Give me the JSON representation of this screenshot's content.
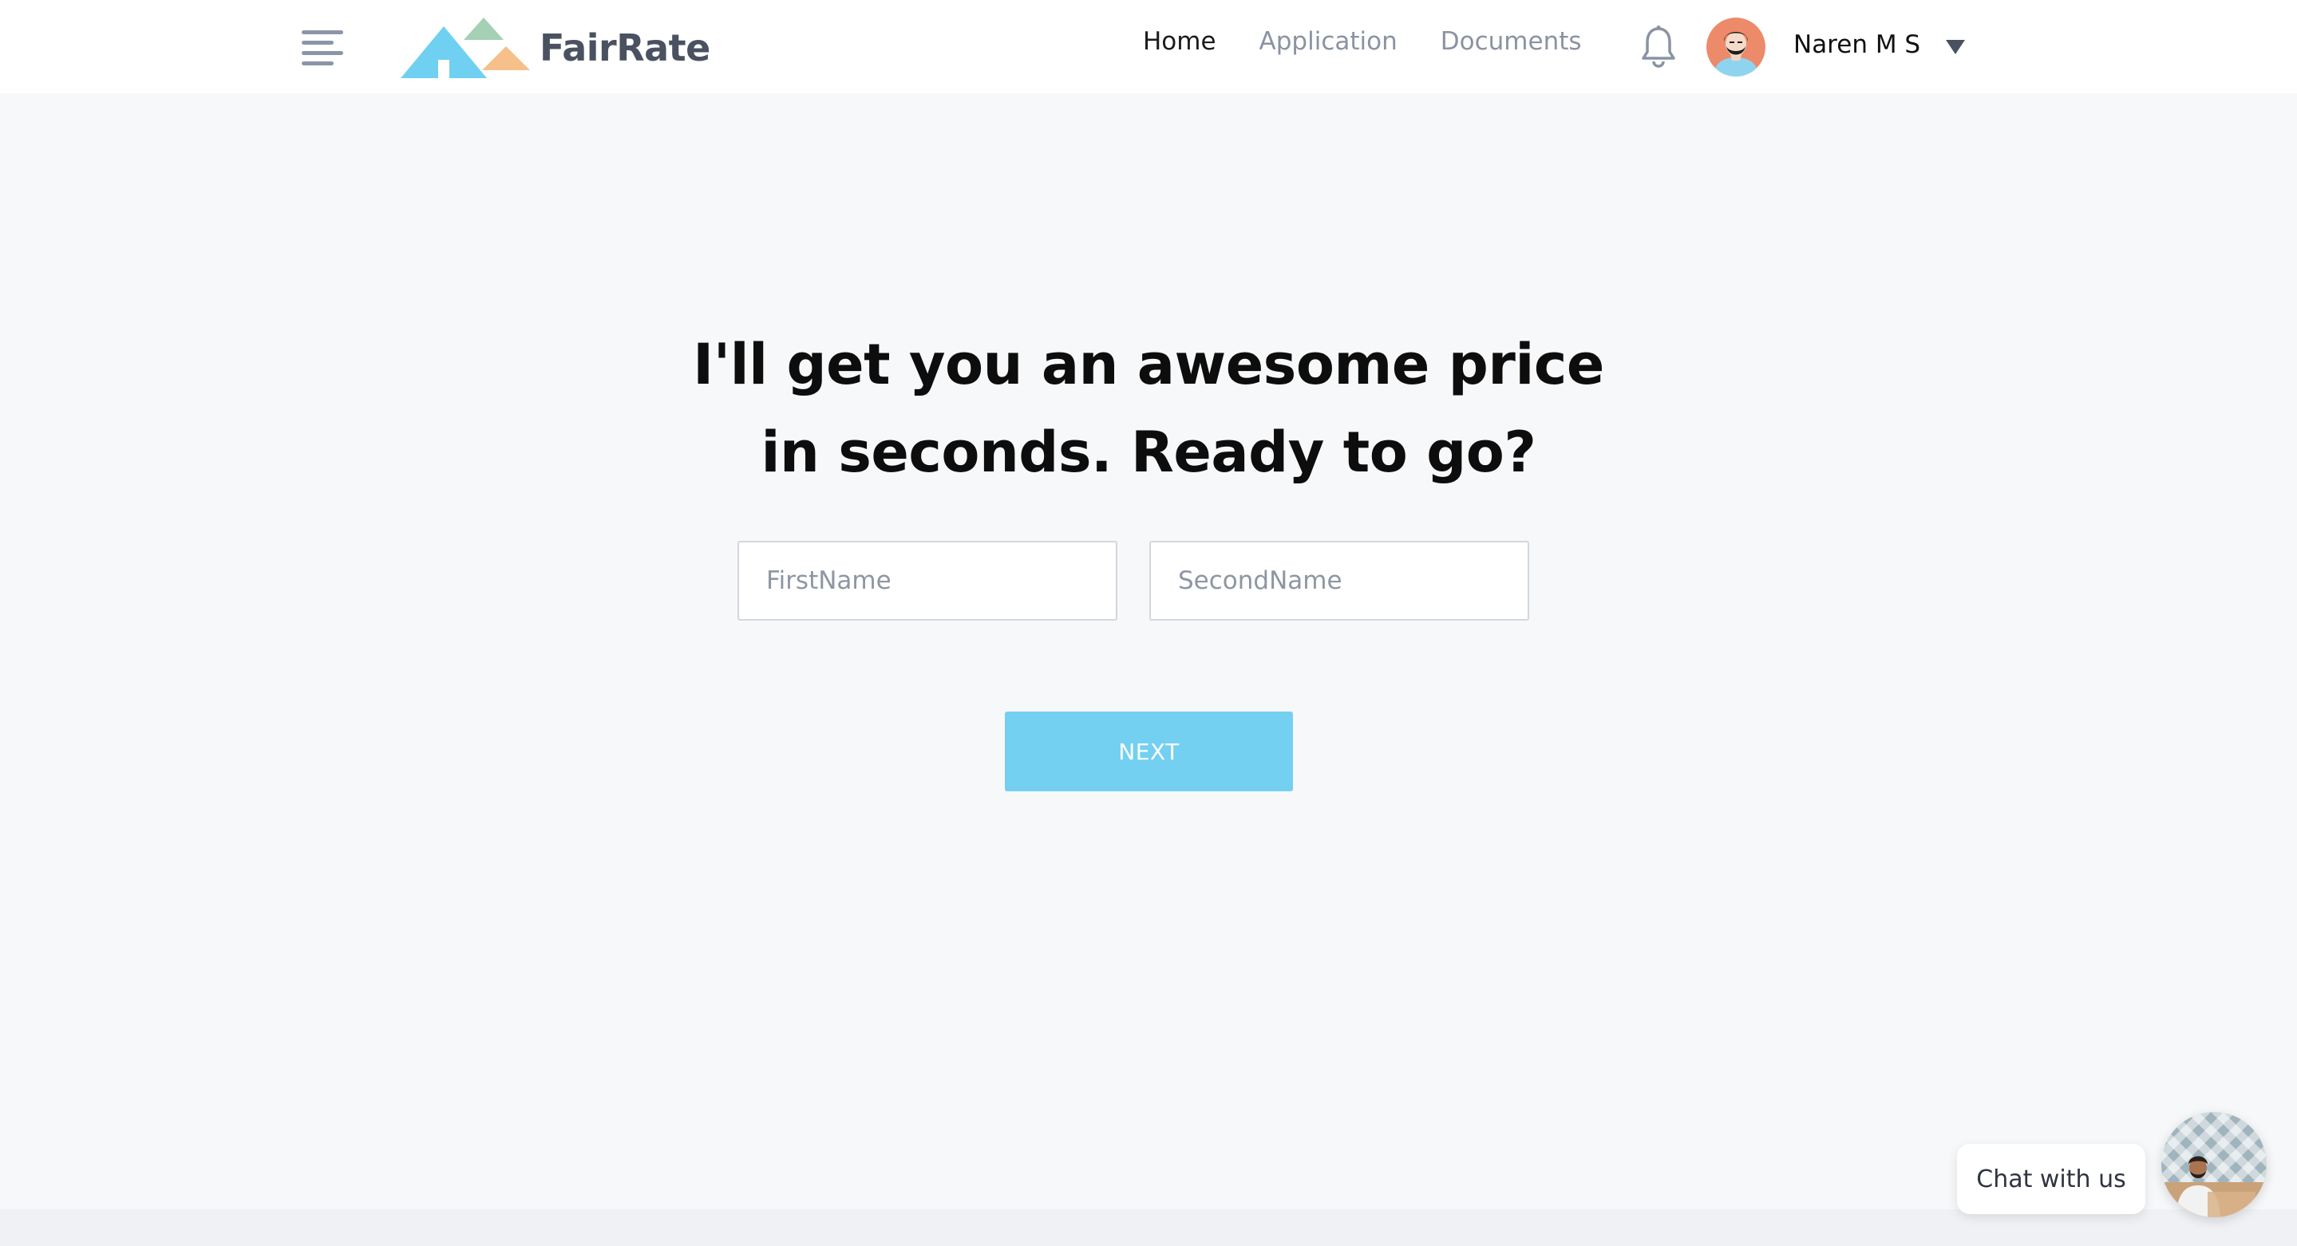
{
  "header": {
    "brand": "FairRate",
    "nav": [
      {
        "label": "Home",
        "active": true
      },
      {
        "label": "Application",
        "active": false
      },
      {
        "label": "Documents",
        "active": false
      }
    ],
    "user": {
      "name": "Naren M S"
    },
    "icons": [
      "menu-icon",
      "logo-mountains-icon",
      "bell-icon",
      "avatar",
      "caret-down-icon"
    ]
  },
  "main": {
    "headline_line1": "I'll get you an awesome price",
    "headline_line2": "in seconds. Ready to go?",
    "first_name": {
      "value": "",
      "placeholder": "FirstName"
    },
    "second_name": {
      "value": "",
      "placeholder": "SecondName"
    },
    "next_label": "NEXT"
  },
  "chat": {
    "label": "Chat with us"
  },
  "colors": {
    "accent": "#74d0f1",
    "page_bg": "#f7f8fa",
    "header_bg": "#ffffff",
    "nav_inactive": "#8a93a2",
    "logo_blue": "#6fd0f2",
    "logo_green": "#a4d0b3",
    "logo_orange": "#f6c08a",
    "avatar_bg": "#ec8a6a"
  }
}
